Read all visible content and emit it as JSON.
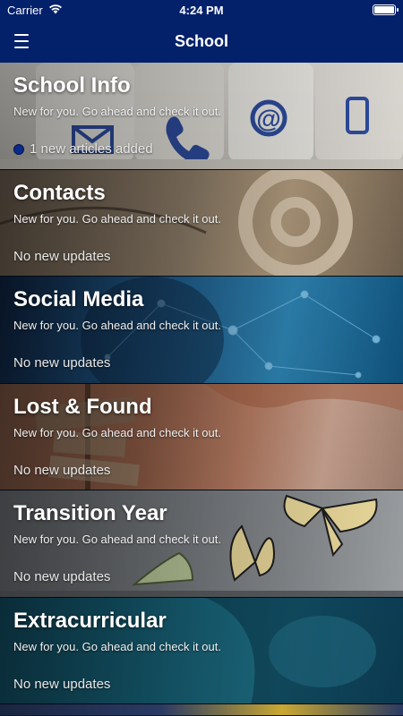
{
  "status_bar": {
    "carrier": "Carrier",
    "time": "4:24 PM",
    "wifi_icon": "wifi-icon",
    "battery_icon": "battery-icon",
    "battery_level": 1.0
  },
  "nav": {
    "title": "School",
    "menu_icon": "hamburger-menu-icon"
  },
  "cards": [
    {
      "title": "School Info",
      "subtitle": "New for you. Go ahead and check it out.",
      "status": "1 new articles added",
      "has_new": true
    },
    {
      "title": "Contacts",
      "subtitle": "New for you. Go ahead and check it out.",
      "status": "No new updates",
      "has_new": false
    },
    {
      "title": "Social Media",
      "subtitle": "New for you. Go ahead and check it out.",
      "status": "No new updates",
      "has_new": false
    },
    {
      "title": "Lost & Found",
      "subtitle": "New for you. Go ahead and check it out.",
      "status": "No new updates",
      "has_new": false
    },
    {
      "title": "Transition Year",
      "subtitle": "New for you. Go ahead and check it out.",
      "status": "No new updates",
      "has_new": false
    },
    {
      "title": "Extracurricular",
      "subtitle": "New for you. Go ahead and check it out.",
      "status": "No new updates",
      "has_new": false
    }
  ],
  "colors": {
    "nav_background": "#03206a",
    "new_indicator": "#0a2a8a"
  }
}
